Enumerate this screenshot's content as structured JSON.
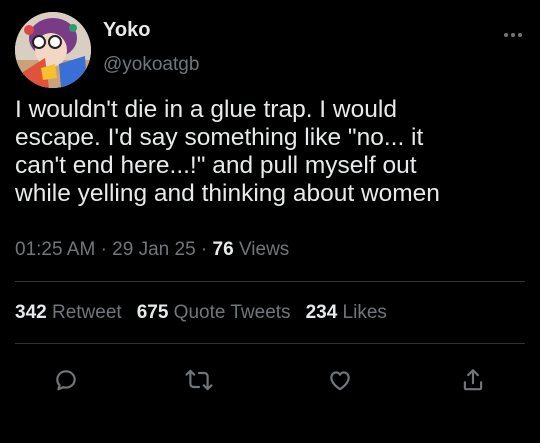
{
  "author": {
    "display_name": "Yoko",
    "handle": "@yokoatgb"
  },
  "tweet": {
    "text": "I wouldn't die in a glue trap. I would\nescape. I'd say something like \"no... it\ncan't end here...!\" and pull myself out\nwhile yelling and thinking about women",
    "time": "01:25 AM",
    "date": "29 Jan 25",
    "views_count": "76",
    "views_label": "Views",
    "separator": "·"
  },
  "stats": {
    "retweets_count": "342",
    "retweets_label": "Retweet",
    "quotes_count": "675",
    "quotes_label": "Quote Tweets",
    "likes_count": "234",
    "likes_label": "Likes"
  },
  "actions": [
    "reply-icon",
    "retweet-icon",
    "like-icon",
    "share-icon"
  ],
  "icons": {
    "more": "more-horizontal-icon"
  },
  "colors": {
    "background": "#000000",
    "primary_text": "#e7e9ea",
    "secondary_text": "#71767b",
    "divider": "#2f3336"
  }
}
